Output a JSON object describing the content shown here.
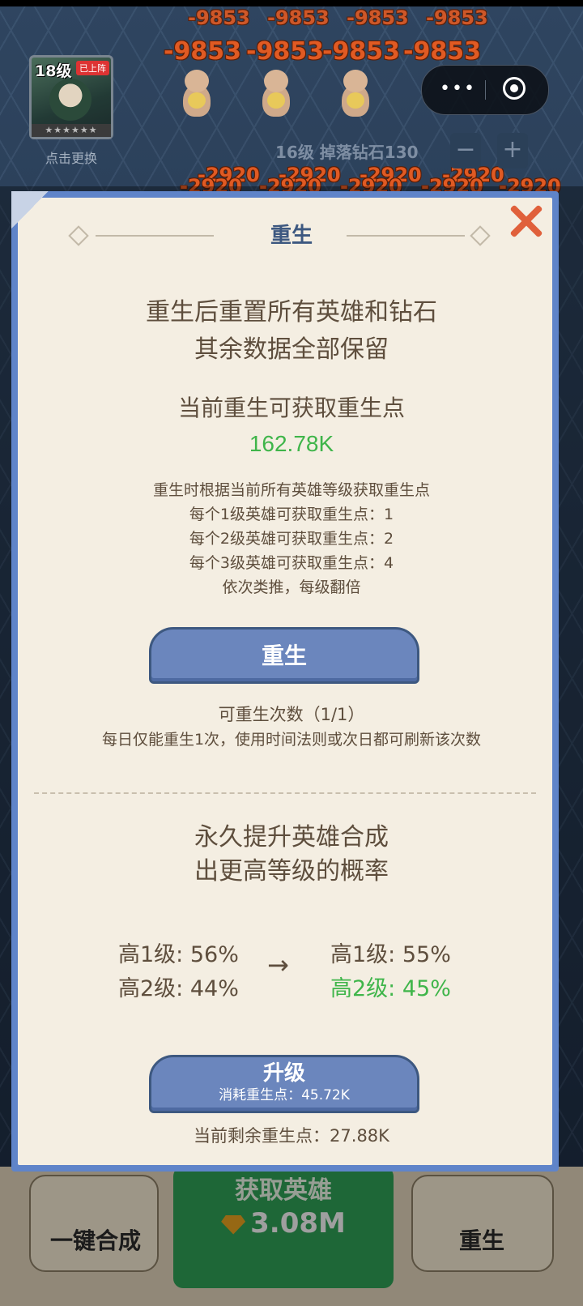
{
  "game": {
    "damage_top": [
      "-9853",
      "-9853",
      "-9853",
      "-9853"
    ],
    "damage_row2": [
      "-9853",
      "-9853",
      "-9853",
      "-9853"
    ],
    "damage_mid": [
      "-2920",
      "-2920",
      "-2920",
      "-2920"
    ],
    "damage_mid2": [
      "-2920",
      "-2920",
      "-2920",
      "-2920",
      "-2920"
    ],
    "hero_level": "18级",
    "hero_tag": "已上阵",
    "hero_stars": "★★★★★★",
    "change_label": "点击更换",
    "wave_label": "16级 掉落钻石130",
    "minus": "−",
    "plus": "+",
    "capsule_dots": "•••"
  },
  "bottom": {
    "merge_label": "一键合成",
    "get_hero_title": "获取英雄",
    "get_hero_cost": "3.08M",
    "rebirth_label": "重生"
  },
  "dialog": {
    "title": "重生",
    "desc_line1": "重生后重置所有英雄和钻石",
    "desc_line2": "其余数据全部保留",
    "current_title": "当前重生可获取重生点",
    "current_value": "162.78K",
    "rules": [
      "重生时根据当前所有英雄等级获取重生点",
      "每个1级英雄可获取重生点：1",
      "每个2级英雄可获取重生点：2",
      "每个3级英雄可获取重生点：4",
      "依次类推，每级翻倍"
    ],
    "rebirth_button": "重生",
    "count_text": "可重生次数（1/1）",
    "daily_note": "每日仅能重生1次，使用时间法则或次日都可刷新该次数",
    "upgrade_title1": "永久提升英雄合成",
    "upgrade_title2": "出更高等级的概率",
    "rates_before": [
      "高1级: 56%",
      "高2级: 44%"
    ],
    "arrow": "→",
    "rates_after": [
      "高1级: 55%",
      "高2级: 45%"
    ],
    "upgrade_button": "升级",
    "upgrade_cost": "消耗重生点：45.72K",
    "remaining": "当前剩余重生点：27.88K"
  }
}
